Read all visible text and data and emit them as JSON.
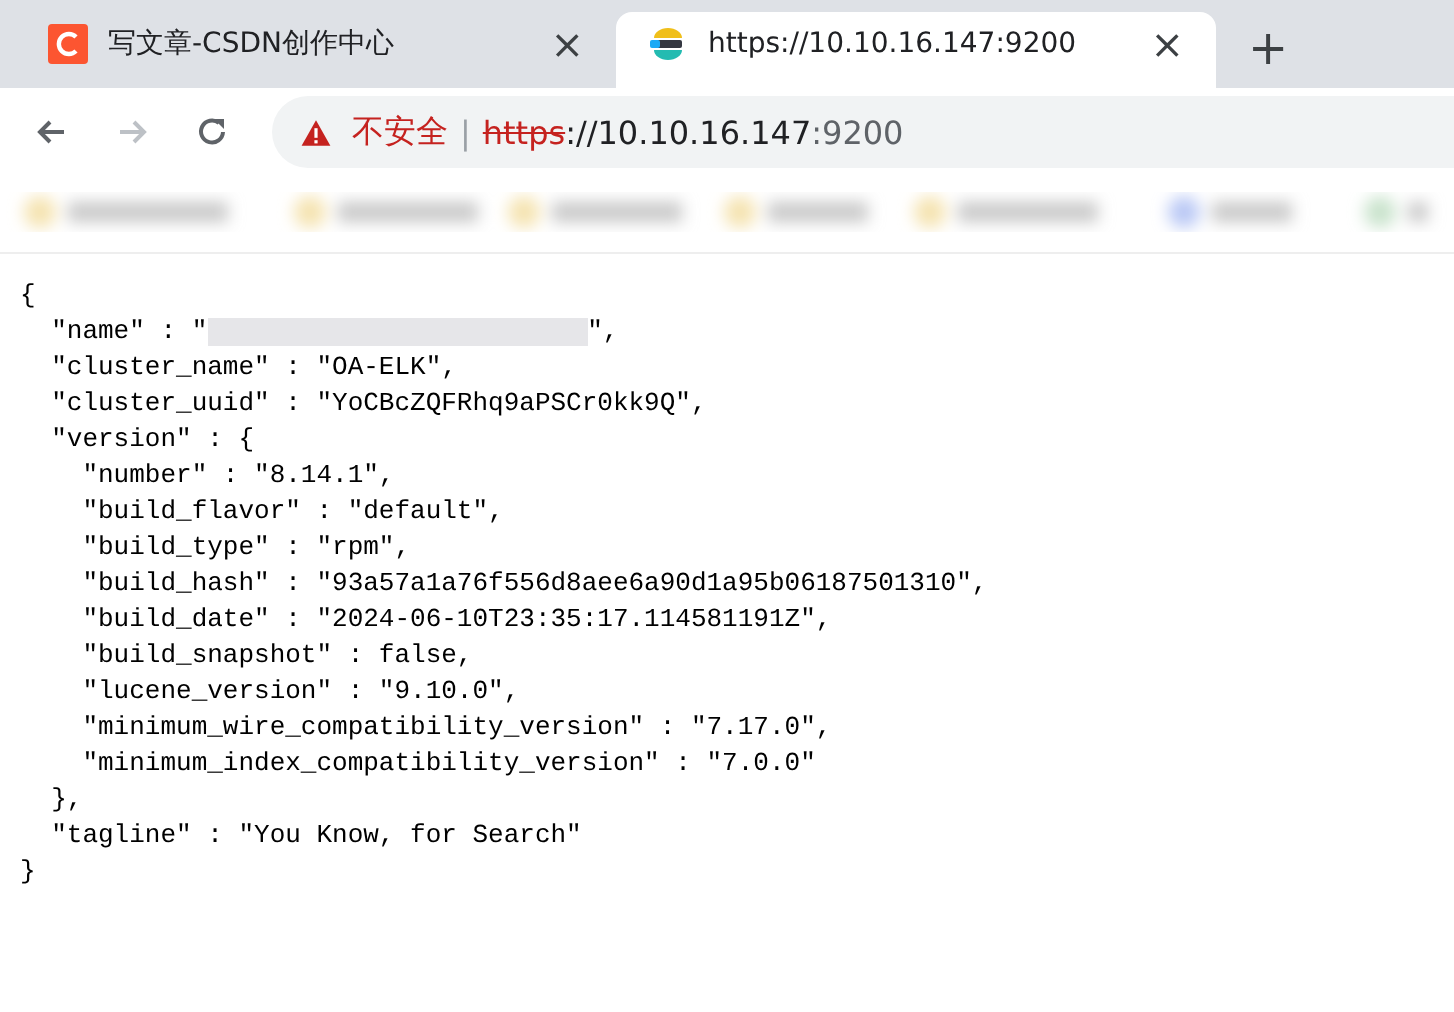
{
  "tabs": [
    {
      "title": "写文章-CSDN创作中心",
      "kind": "csdn",
      "selected": false,
      "close": "×"
    },
    {
      "title": "https://10.10.16.147:9200",
      "kind": "elastic",
      "selected": true,
      "close": "×"
    }
  ],
  "new_tab": "+",
  "address_bar": {
    "security_label": "不安全",
    "separator": "|",
    "scheme": "https",
    "host": "://10.10.16.147",
    "port": ":9200"
  },
  "document": {
    "lines": [
      {
        "kind": "text",
        "text": "{"
      },
      {
        "kind": "redacted",
        "prefix": "  \"name\" : \"",
        "suffix": "\","
      },
      {
        "kind": "text",
        "text": "  \"cluster_name\" : \"OA-ELK\","
      },
      {
        "kind": "text",
        "text": "  \"cluster_uuid\" : \"YoCBcZQFRhq9aPSCr0kk9Q\","
      },
      {
        "kind": "text",
        "text": "  \"version\" : {"
      },
      {
        "kind": "text",
        "text": "    \"number\" : \"8.14.1\","
      },
      {
        "kind": "text",
        "text": "    \"build_flavor\" : \"default\","
      },
      {
        "kind": "text",
        "text": "    \"build_type\" : \"rpm\","
      },
      {
        "kind": "text",
        "text": "    \"build_hash\" : \"93a57a1a76f556d8aee6a90d1a95b06187501310\","
      },
      {
        "kind": "text",
        "text": "    \"build_date\" : \"2024-06-10T23:35:17.114581191Z\","
      },
      {
        "kind": "text",
        "text": "    \"build_snapshot\" : false,"
      },
      {
        "kind": "text",
        "text": "    \"lucene_version\" : \"9.10.0\","
      },
      {
        "kind": "text",
        "text": "    \"minimum_wire_compatibility_version\" : \"7.17.0\","
      },
      {
        "kind": "text",
        "text": "    \"minimum_index_compatibility_version\" : \"7.0.0\""
      },
      {
        "kind": "text",
        "text": "  },"
      },
      {
        "kind": "text",
        "text": "  \"tagline\" : \"You Know, for Search\""
      },
      {
        "kind": "text",
        "text": "}"
      }
    ]
  }
}
